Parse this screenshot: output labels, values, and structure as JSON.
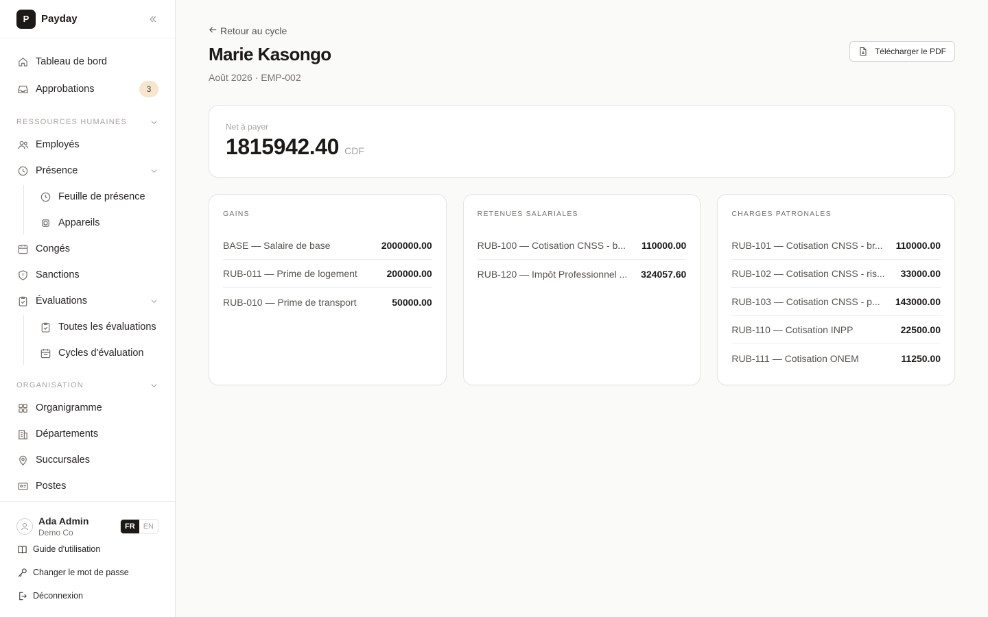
{
  "app": {
    "name": "Payday",
    "logo_letter": "P"
  },
  "sidebar": {
    "top_items": [
      {
        "label": "Tableau de bord",
        "icon": "home-icon"
      },
      {
        "label": "Approbations",
        "icon": "inbox-icon",
        "badge": "3"
      }
    ],
    "hr_section": "RESSOURCES HUMAINES",
    "hr_items": {
      "employees": "Employés",
      "presence": "Présence",
      "presence_sub": [
        "Feuille de présence",
        "Appareils"
      ],
      "leaves": "Congés",
      "sanctions": "Sanctions",
      "evaluations": "Évaluations",
      "evaluations_sub": [
        "Toutes les évaluations",
        "Cycles d'évaluation"
      ]
    },
    "org_section": "ORGANISATION",
    "org_items": [
      "Organigramme",
      "Départements",
      "Succursales",
      "Postes"
    ],
    "user": {
      "name": "Ada Admin",
      "org": "Demo Co"
    },
    "lang": {
      "active": "FR",
      "inactive": "EN"
    },
    "footer_links": [
      "Guide d'utilisation",
      "Changer le mot de passe",
      "Déconnexion"
    ]
  },
  "header": {
    "back_link": "Retour au cycle",
    "title": "Marie Kasongo",
    "subtitle": "Août 2026 · EMP-002",
    "pdf_button": "Télécharger le PDF"
  },
  "net": {
    "label": "Net à payer",
    "value": "1815942.40",
    "currency": "CDF"
  },
  "cards": {
    "gains": {
      "title": "GAINS",
      "rows": [
        {
          "label": "BASE — Salaire de base",
          "value": "2000000.00"
        },
        {
          "label": "RUB-011 — Prime de logement",
          "value": "200000.00"
        },
        {
          "label": "RUB-010 — Prime de transport",
          "value": "50000.00"
        }
      ]
    },
    "retenues": {
      "title": "RETENUES SALARIALES",
      "rows": [
        {
          "label": "RUB-100 — Cotisation CNSS - b...",
          "value": "110000.00"
        },
        {
          "label": "RUB-120 — Impôt Professionnel ...",
          "value": "324057.60"
        }
      ]
    },
    "charges": {
      "title": "CHARGES PATRONALES",
      "rows": [
        {
          "label": "RUB-101 — Cotisation CNSS - br...",
          "value": "110000.00"
        },
        {
          "label": "RUB-102 — Cotisation CNSS - ris...",
          "value": "33000.00"
        },
        {
          "label": "RUB-103 — Cotisation CNSS - p...",
          "value": "143000.00"
        },
        {
          "label": "RUB-110 — Cotisation INPP",
          "value": "22500.00"
        },
        {
          "label": "RUB-111 — Cotisation ONEM",
          "value": "11250.00"
        }
      ]
    }
  }
}
